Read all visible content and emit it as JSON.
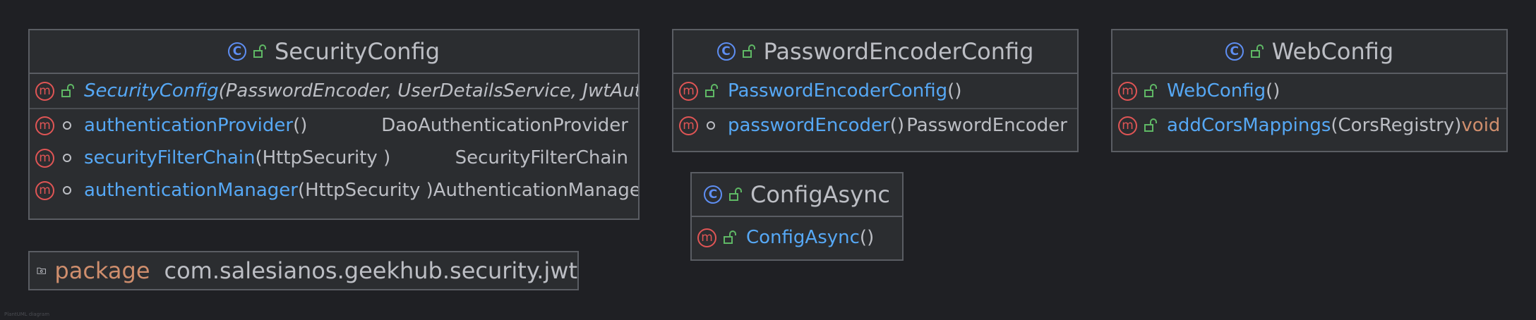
{
  "classes": {
    "security_config": {
      "name": "SecurityConfig",
      "class_icon": "C",
      "members": [
        {
          "name": "SecurityConfig",
          "params": "(PasswordEncoder, UserDetailsService, JwtAuth",
          "return": ""
        },
        {
          "name": "authenticationProvider",
          "params": " ()",
          "return": "DaoAuthenticationProvider"
        },
        {
          "name": "securityFilterChain",
          "params": " (HttpSecurity )",
          "return": "SecurityFilterChain"
        },
        {
          "name": "authenticationManager",
          "params": " (HttpSecurity )",
          "return": "AuthenticationManager"
        }
      ]
    },
    "password_encoder_config": {
      "name": "PasswordEncoderConfig",
      "class_icon": "C",
      "members": [
        {
          "name": "PasswordEncoderConfig",
          "params": "()",
          "return": ""
        },
        {
          "name": "passwordEncoder",
          "params": "()",
          "return": "PasswordEncoder"
        }
      ]
    },
    "web_config": {
      "name": "WebConfig",
      "class_icon": "C",
      "members": [
        {
          "name": "WebConfig",
          "params": "()",
          "return": ""
        },
        {
          "name": "addCorsMappings",
          "params": "(CorsRegistry)",
          "return": "void"
        }
      ]
    },
    "config_async": {
      "name": "ConfigAsync",
      "class_icon": "C",
      "members": [
        {
          "name": "ConfigAsync",
          "params": "()",
          "return": ""
        }
      ]
    }
  },
  "method_icon": "m",
  "package": {
    "keyword": "package",
    "name": "com.salesianos.geekhub.security.jwt"
  },
  "watermark": "PlantUML diagram",
  "colors": {
    "background": "#1f2024",
    "box": "#2b2d30",
    "border": "#5a5d63",
    "method_name": "#56a8f5",
    "keyword": "#cf8e6d",
    "method_icon": "#e05555",
    "class_icon": "#5e8ef2",
    "public_lock": "#5fb865"
  },
  "icons": [
    "class-icon",
    "method-icon",
    "public-lock-icon",
    "package-private-circle-icon",
    "folder-icon"
  ]
}
